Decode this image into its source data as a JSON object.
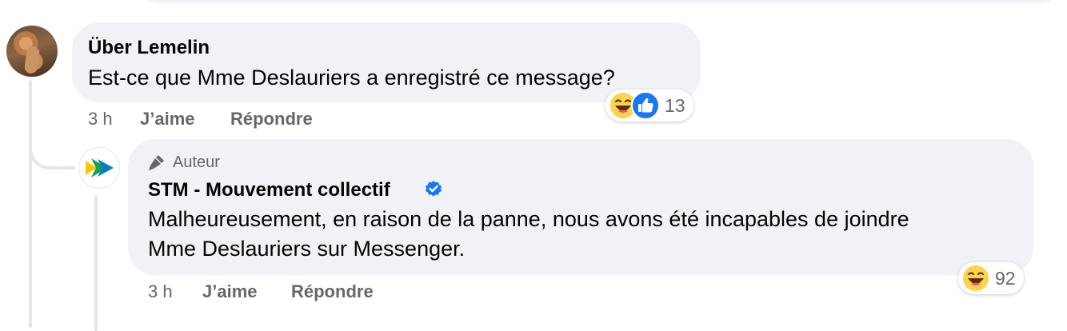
{
  "comment": {
    "author": "Über Lemelin",
    "text": "Est-ce que Mme Deslauriers a enregistré ce message?",
    "time": "3 h",
    "like_label": "J’aime",
    "reply_label": "Répondre",
    "reaction_count": "13",
    "reactions": [
      "haha-icon",
      "like-icon"
    ]
  },
  "reply": {
    "badge": "Auteur",
    "author": "STM - Mouvement collectif",
    "verified": true,
    "text_line1": "Malheureusement, en raison de la panne, nous avons été incapables de joindre",
    "text_line2": "Mme Deslauriers sur Messenger.",
    "time": "3 h",
    "like_label": "J’aime",
    "reply_label": "Répondre",
    "reaction_count": "92",
    "reactions": [
      "haha-icon"
    ]
  },
  "colors": {
    "bubble": "#f0f2f5",
    "secondary_text": "#65676b",
    "verified_blue": "#1877f2",
    "thread_line": "#e4e6eb"
  }
}
